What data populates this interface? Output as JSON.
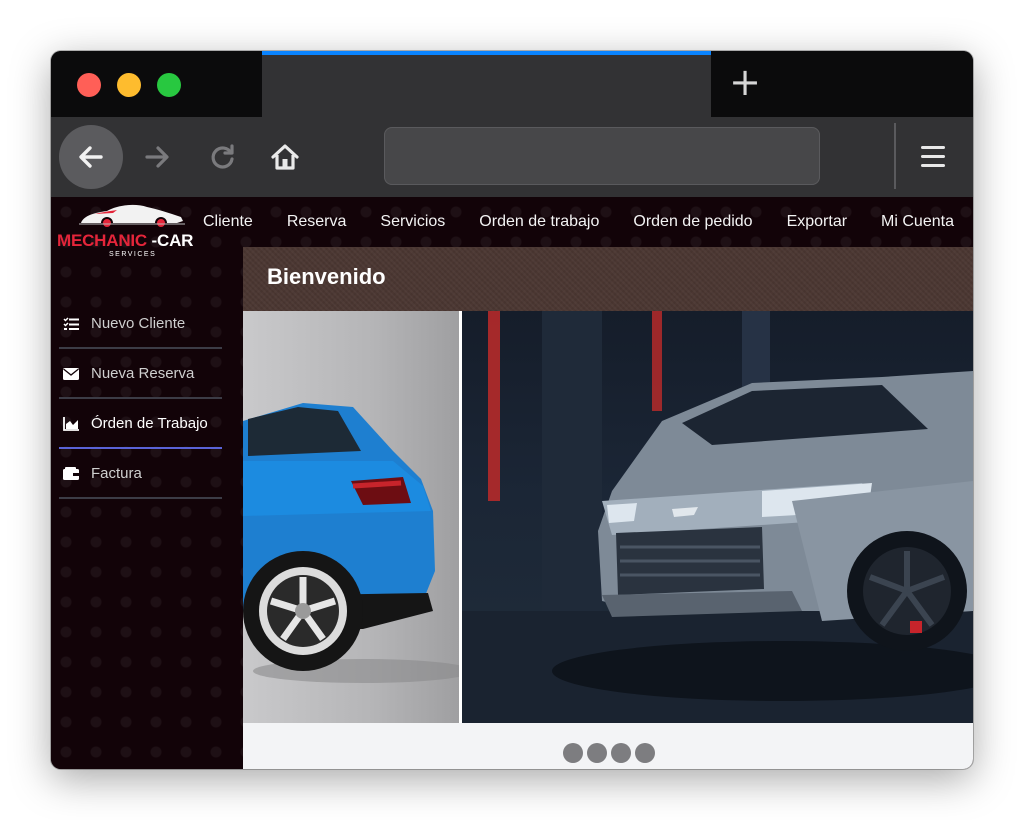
{
  "browser": {
    "new_tab_label": "+",
    "active_tab_title": "",
    "url": ""
  },
  "brand": {
    "name_part1": "MECHANIC",
    "name_part2": " -CAR",
    "subtitle": "SERVICES"
  },
  "topnav": {
    "items": [
      {
        "label": "Cliente"
      },
      {
        "label": "Reserva"
      },
      {
        "label": "Servicios"
      },
      {
        "label": "Orden de trabajo"
      },
      {
        "label": "Orden de pedido"
      },
      {
        "label": "Exportar"
      },
      {
        "label": "Mi Cuenta"
      }
    ]
  },
  "sidebar": {
    "items": [
      {
        "label": "Nuevo Cliente",
        "icon": "list-check-icon"
      },
      {
        "label": "Nueva Reserva",
        "icon": "envelope-icon"
      },
      {
        "label": "Órden de Trabajo",
        "icon": "chart-area-icon",
        "active": true
      },
      {
        "label": "Factura",
        "icon": "wallet-icon"
      }
    ]
  },
  "main": {
    "heading": "Bienvenido",
    "carousel": {
      "slides": [
        "blue-suv-image",
        "silver-suv-image"
      ],
      "indicator_count": 4
    }
  },
  "colors": {
    "brand_red": "#e4253a",
    "tab_accent": "#0a84ff",
    "sidebar_active": "#5a63d8",
    "page_bg": "#120308",
    "banner": "#4b3732"
  }
}
